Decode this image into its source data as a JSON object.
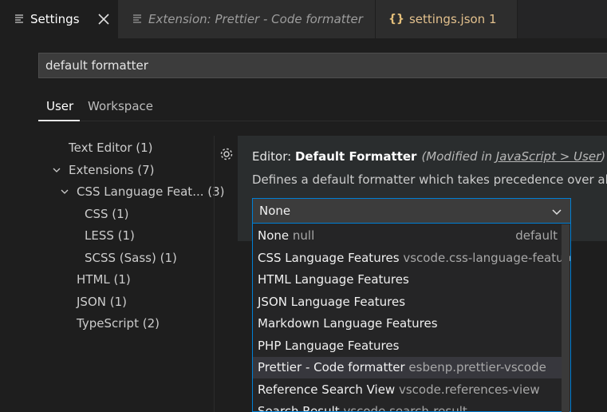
{
  "tabs": [
    {
      "label": "Settings",
      "icon": "lines-icon"
    },
    {
      "label": "Extension: Prettier - Code formatter",
      "icon": "lines-icon"
    },
    {
      "label": "settings.json 1",
      "icon": "json-braces-icon",
      "icon_text": "{}"
    }
  ],
  "search": {
    "value": "default formatter"
  },
  "scopes": {
    "user": "User",
    "workspace": "Workspace"
  },
  "tree": [
    {
      "label": "Text Editor (1)"
    },
    {
      "label": "Extensions (7)"
    },
    {
      "label": "CSS Language Feat... (3)"
    },
    {
      "label": "CSS (1)"
    },
    {
      "label": "LESS (1)"
    },
    {
      "label": "SCSS (Sass) (1)"
    },
    {
      "label": "HTML (1)"
    },
    {
      "label": "JSON (1)"
    },
    {
      "label": "TypeScript (2)"
    }
  ],
  "setting": {
    "category": "Editor: ",
    "name": "Default Formatter",
    "modified_prefix": "(Modified in ",
    "modified_link": "JavaScript > User",
    "modified_suffix": ")",
    "description": "Defines a default formatter which takes precedence over all oth",
    "selected": "None"
  },
  "options": [
    {
      "name": "None",
      "id": "null",
      "badge": "default"
    },
    {
      "name": "CSS Language Features",
      "id": "vscode.css-language-features"
    },
    {
      "name": "HTML Language Features",
      "id": ""
    },
    {
      "name": "JSON Language Features",
      "id": ""
    },
    {
      "name": "Markdown Language Features",
      "id": ""
    },
    {
      "name": "PHP Language Features",
      "id": ""
    },
    {
      "name": "Prettier - Code formatter",
      "id": "esbenp.prettier-vscode"
    },
    {
      "name": "Reference Search View",
      "id": "vscode.references-view"
    },
    {
      "name": "Search Result",
      "id": "vscode.search-result"
    }
  ],
  "colors": {
    "accent": "#007fd4",
    "json_icon": "#e5c07b",
    "background": "#1e1e1e"
  }
}
